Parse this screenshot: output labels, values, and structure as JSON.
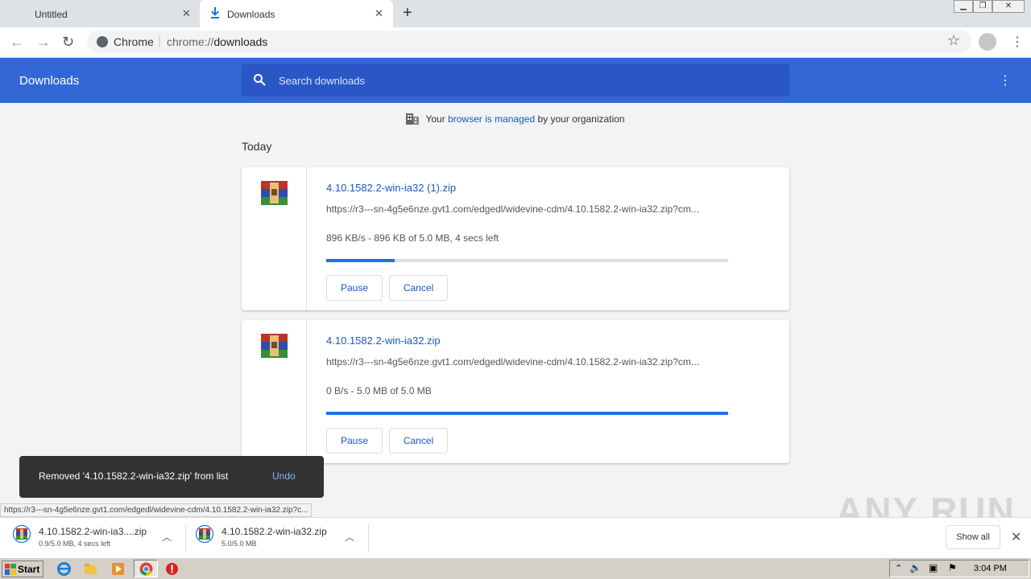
{
  "browser": {
    "tabs": [
      {
        "label": "Untitled"
      },
      {
        "label": "Downloads"
      }
    ],
    "omnibox": {
      "site_label": "Chrome",
      "url_prefix": "chrome://",
      "url_host": "downloads"
    }
  },
  "downloads_page": {
    "title": "Downloads",
    "search_placeholder": "Search downloads",
    "managed_prefix": "Your ",
    "managed_link": "browser is managed",
    "managed_suffix": " by your organization",
    "section_label": "Today",
    "items": [
      {
        "name": "4.10.1582.2-win-ia32 (1).zip",
        "url": "https://r3---sn-4g5e6nze.gvt1.com/edgedl/widevine-cdm/4.10.1582.2-win-ia32.zip?cm...",
        "status": "896 KB/s - 896 KB of 5.0 MB, 4 secs left",
        "progress": 0.17,
        "pause_label": "Pause",
        "cancel_label": "Cancel"
      },
      {
        "name": "4.10.1582.2-win-ia32.zip",
        "url": "https://r3---sn-4g5e6nze.gvt1.com/edgedl/widevine-cdm/4.10.1582.2-win-ia32.zip?cm...",
        "status": "0 B/s - 5.0 MB of 5.0 MB",
        "progress": 1.0,
        "pause_label": "Pause",
        "cancel_label": "Cancel"
      }
    ]
  },
  "toast": {
    "message": "Removed '4.10.1582.2-win-ia32.zip' from list",
    "undo_label": "Undo"
  },
  "status_url": "https://r3---sn-4g5e6nze.gvt1.com/edgedl/widevine-cdm/4.10.1582.2-win-ia32.zip?c...",
  "watermark": "ANY RUN",
  "shelf": {
    "items": [
      {
        "name": "4.10.1582.2-win-ia3....zip",
        "status": "0.9/5.0 MB, 4 secs left"
      },
      {
        "name": "4.10.1582.2-win-ia32.zip",
        "status": "5.0/5.0 MB"
      }
    ],
    "show_all_label": "Show all"
  },
  "taskbar": {
    "start_label": "Start",
    "clock": "3:04 PM"
  }
}
